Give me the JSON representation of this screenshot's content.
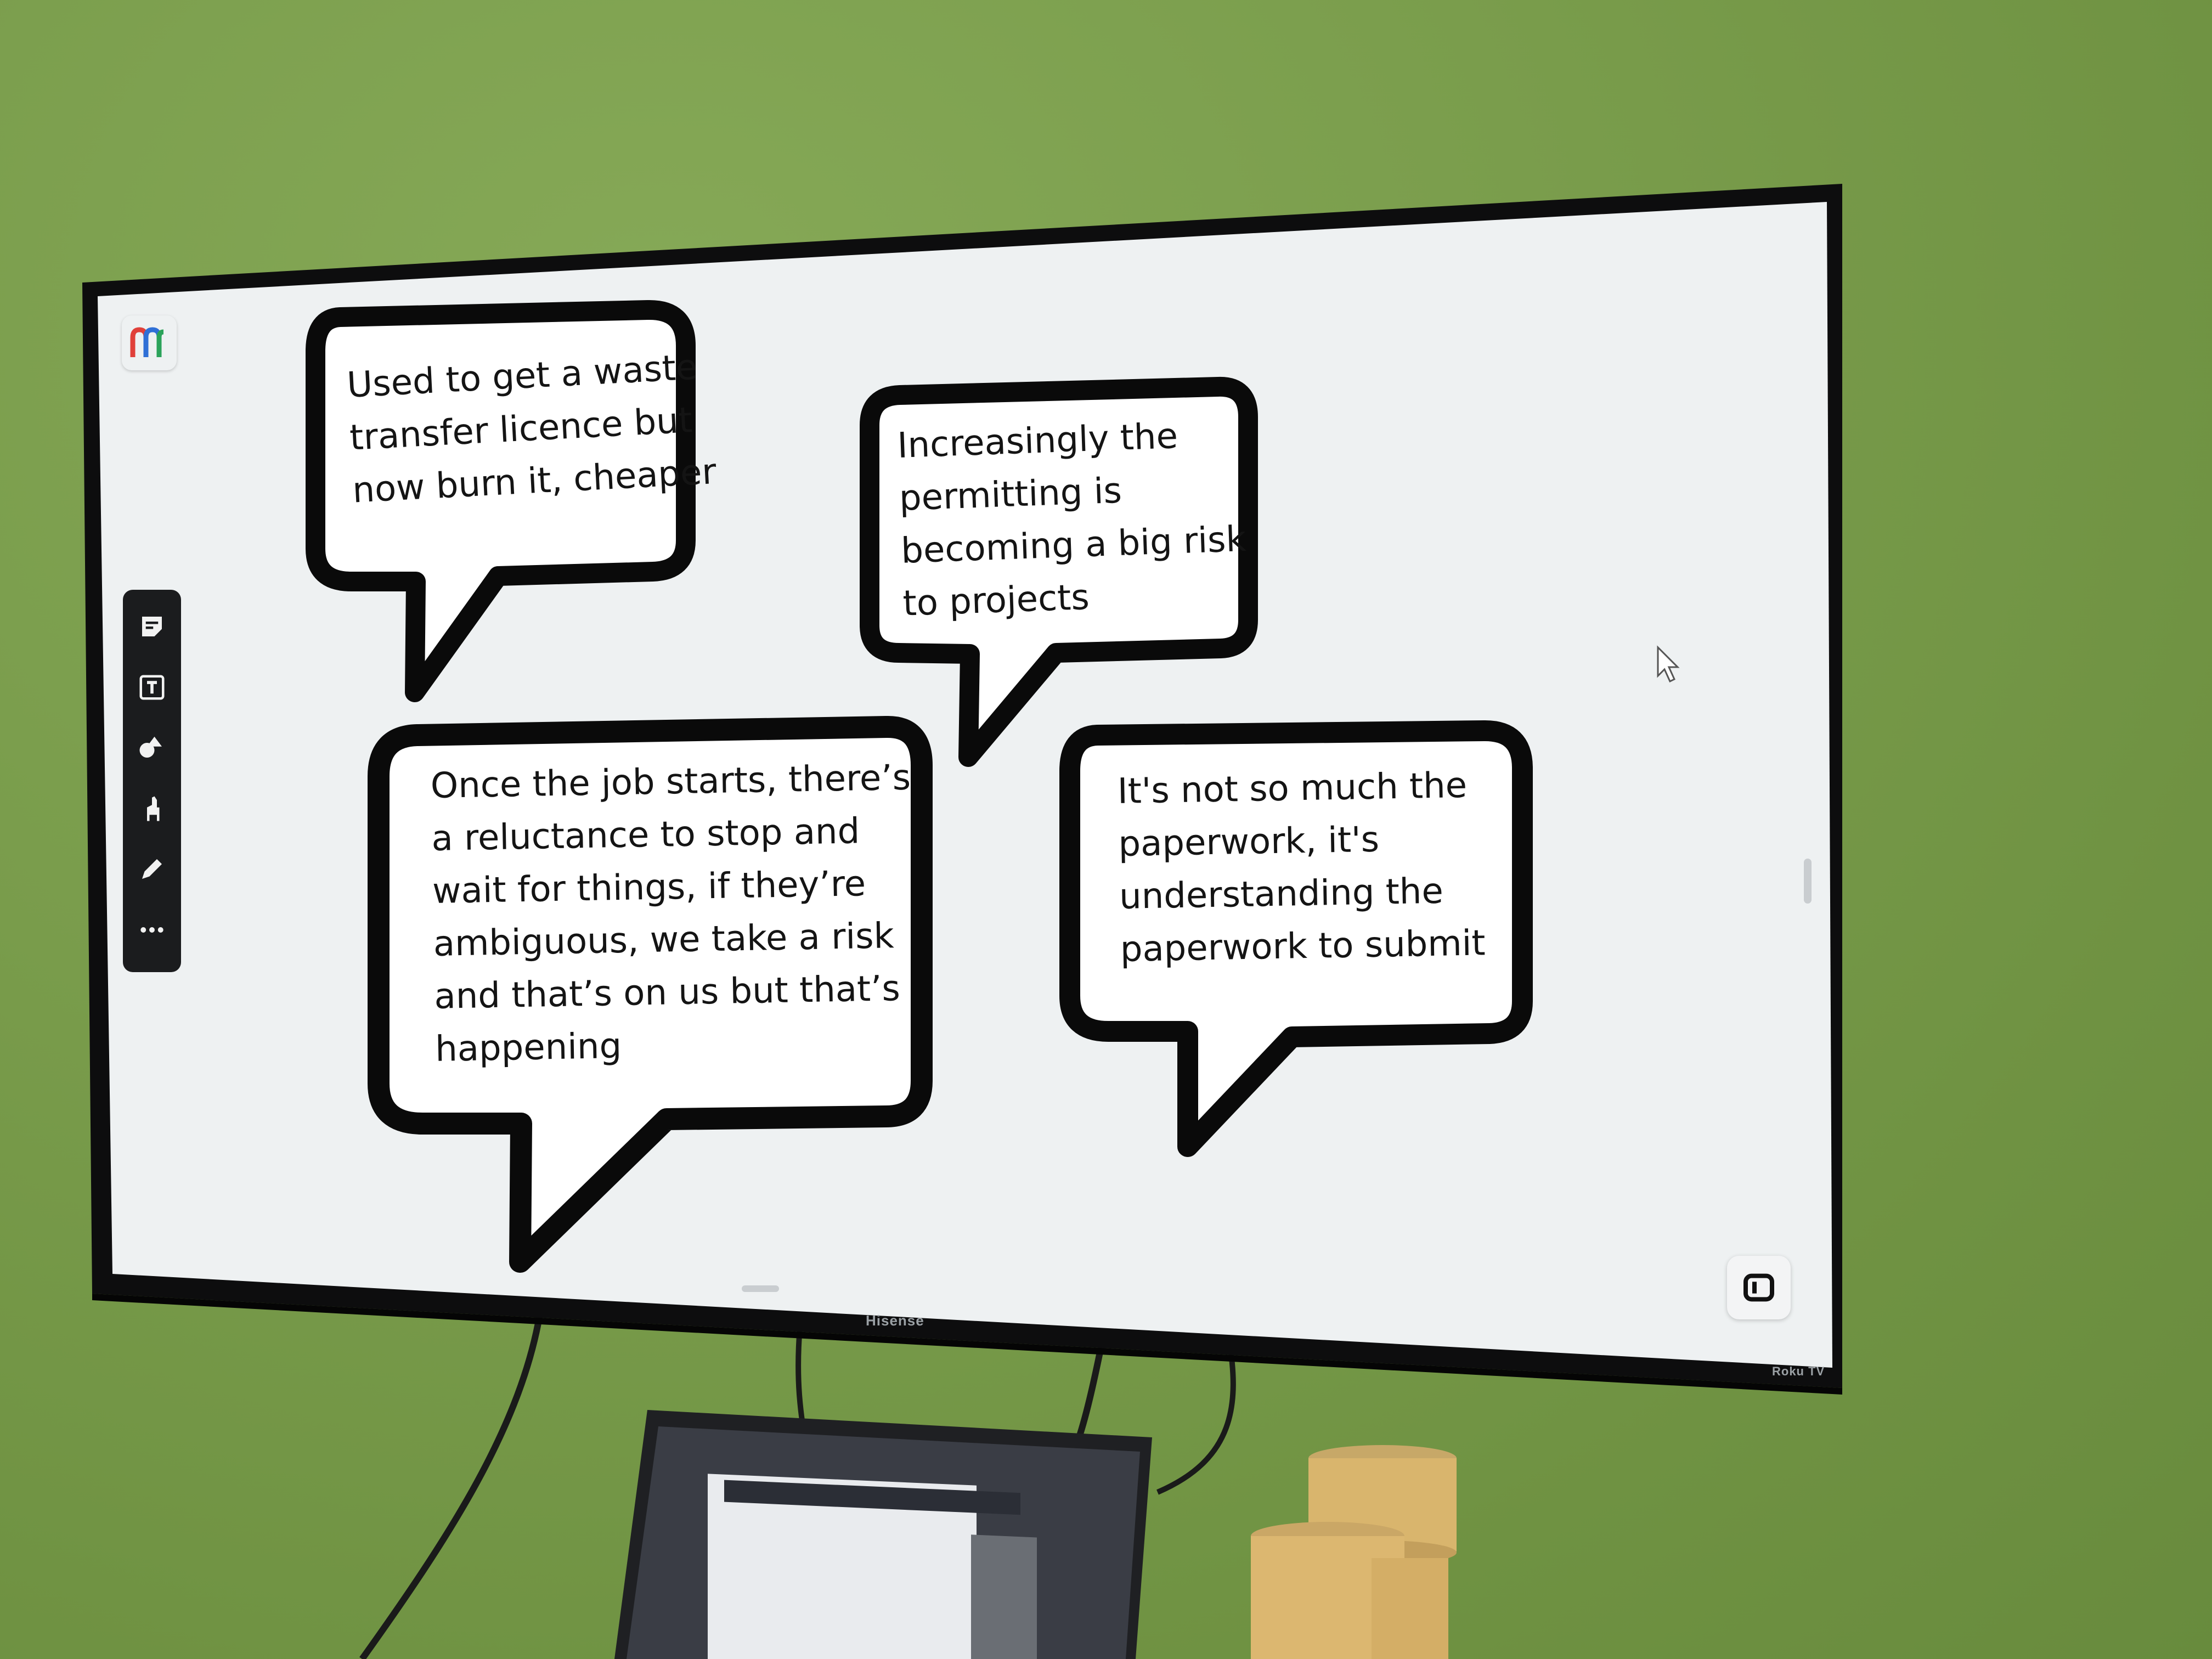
{
  "bubbles": [
    {
      "text": "Used to get a waste\ntransfer licence but\nnow burn it, cheaper"
    },
    {
      "text": "Increasingly the\npermitting is\nbecoming a big risk\n to projects"
    },
    {
      "text": "Once the job starts, there’s\na reluctance to stop and\nwait for things, if they’re\nambiguous, we take a risk\nand that’s on us but that’s\nhappening"
    },
    {
      "text": "It's not so much the\npaperwork, it's\nunderstanding the\npaperwork to submit"
    }
  ],
  "toolbar": {
    "tools": [
      "sticky-note-icon",
      "text-icon",
      "shapes-icon",
      "llama-icon",
      "pen-icon",
      "more-icon"
    ]
  },
  "tv": {
    "brand": "Hisense",
    "badge": "Roku TV"
  },
  "colors": {
    "wall": "#7a9d4c",
    "screen": "#eef1f2",
    "bubble_stroke": "#0a0a0a",
    "toolbar": "#1b1c1e"
  }
}
